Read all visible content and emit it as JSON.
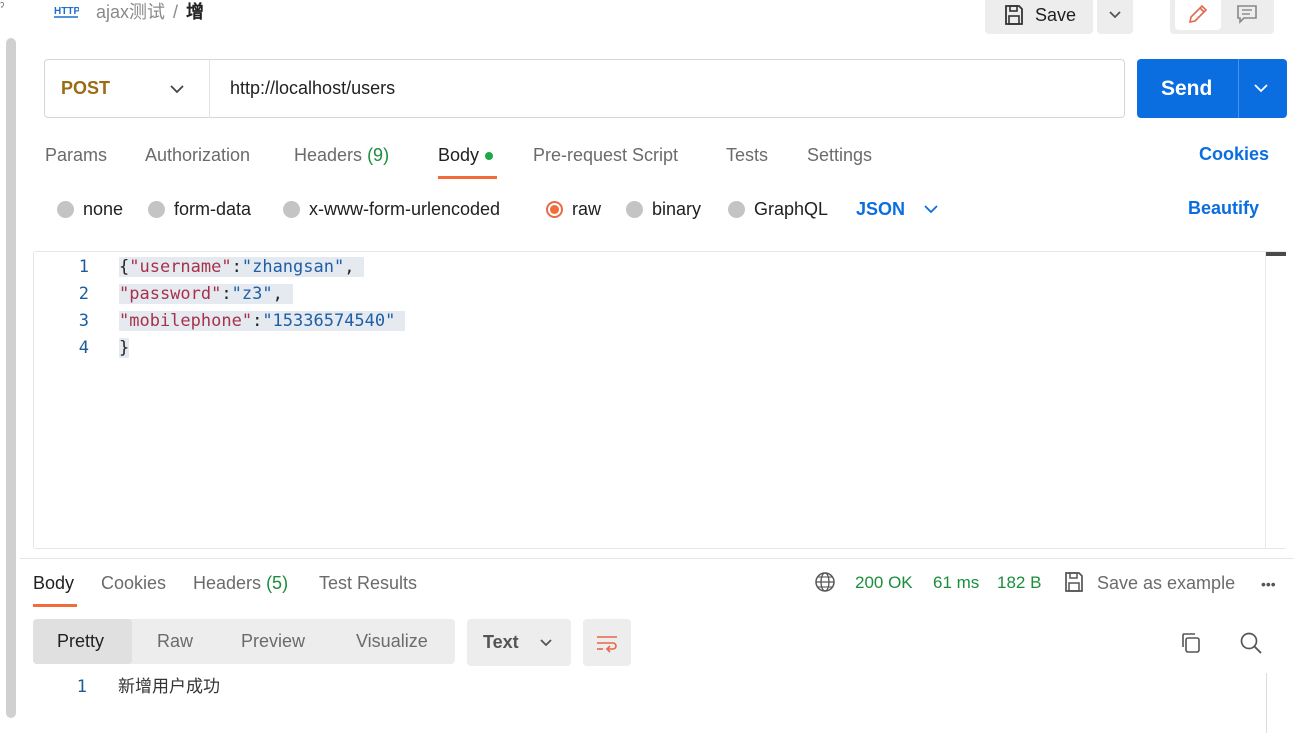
{
  "header": {
    "breadcrumb_collection": "ajax测试",
    "breadcrumb_separator": "/",
    "breadcrumb_request": "增",
    "save_label": "Save"
  },
  "request": {
    "method": "POST",
    "url": "http://localhost/users",
    "send_label": "Send"
  },
  "request_tabs": [
    {
      "label": "Params"
    },
    {
      "label": "Authorization"
    },
    {
      "label": "Headers",
      "count": "(9)"
    },
    {
      "label": "Body"
    },
    {
      "label": "Pre-request Script"
    },
    {
      "label": "Tests"
    },
    {
      "label": "Settings"
    }
  ],
  "cookies_label": "Cookies",
  "body_types": [
    {
      "label": "none"
    },
    {
      "label": "form-data"
    },
    {
      "label": "x-www-form-urlencoded"
    },
    {
      "label": "raw"
    },
    {
      "label": "binary"
    },
    {
      "label": "GraphQL"
    }
  ],
  "raw_format": "JSON",
  "beautify_label": "Beautify",
  "editor": {
    "line_numbers": [
      "1",
      "2",
      "3",
      "4"
    ],
    "line1": {
      "open": "{",
      "key": "\"username\"",
      "colon": ":",
      "value": "\"zhangsan\"",
      "comma": ","
    },
    "line2": {
      "key": "\"password\"",
      "colon": ":",
      "value": "\"z3\"",
      "comma": ","
    },
    "line3": {
      "key": "\"mobilephone\"",
      "colon": ":",
      "value": "\"15336574540\""
    },
    "line4": {
      "close": "}"
    }
  },
  "response": {
    "tabs": [
      {
        "label": "Body"
      },
      {
        "label": "Cookies"
      },
      {
        "label": "Headers",
        "count": "(5)"
      },
      {
        "label": "Test Results"
      }
    ],
    "status": "200 OK",
    "time": "61 ms",
    "size": "182 B",
    "save_example_label": "Save as example",
    "more_label": "•••",
    "views": [
      {
        "label": "Pretty"
      },
      {
        "label": "Raw"
      },
      {
        "label": "Preview"
      },
      {
        "label": "Visualize"
      }
    ],
    "format": "Text",
    "line_number": "1",
    "body_text": "新增用户成功"
  },
  "colors": {
    "accent_orange": "#f26b3a",
    "send_blue": "#0b6ee0",
    "status_green": "#1a8e3b",
    "method_post": "#9a6c13"
  }
}
